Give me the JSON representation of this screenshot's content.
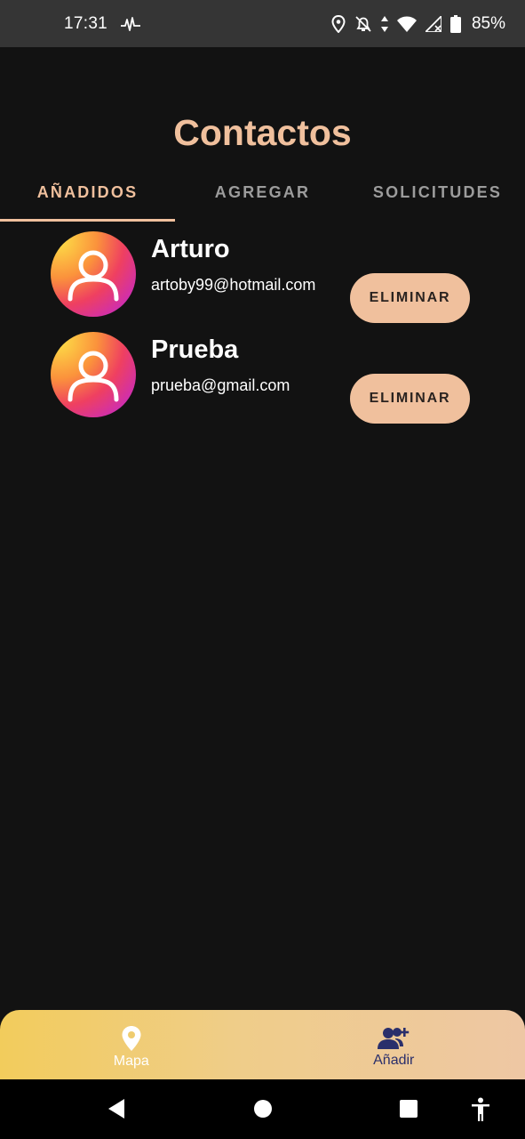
{
  "status_bar": {
    "time": "17:31",
    "battery": "85%",
    "icons": [
      "pulse-icon",
      "location-icon",
      "notifications-off-icon",
      "data-icon",
      "wifi-icon",
      "signal-icon",
      "battery-icon"
    ]
  },
  "header": {
    "title": "Contactos"
  },
  "tabs": [
    {
      "label": "AÑADIDOS",
      "active": true
    },
    {
      "label": "AGREGAR",
      "active": false
    },
    {
      "label": "SOLICITUDES",
      "active": false
    }
  ],
  "contacts": [
    {
      "name": "Arturo",
      "email": "artoby99@hotmail.com",
      "action": "ELIMINAR"
    },
    {
      "name": "Prueba",
      "email": "prueba@gmail.com",
      "action": "ELIMINAR"
    }
  ],
  "bottom_nav": {
    "items": [
      {
        "label": "Mapa",
        "icon": "map-pin-icon",
        "active": true
      },
      {
        "label": "Añadir",
        "icon": "add-user-icon",
        "active": false
      }
    ]
  },
  "colors": {
    "accent": "#f0c09d",
    "background": "#121212",
    "status_bar": "#353535",
    "nav_inactive": "#2a2f6b"
  },
  "system_nav": {
    "icons": [
      "back-icon",
      "home-icon",
      "recents-icon",
      "accessibility-icon"
    ]
  }
}
